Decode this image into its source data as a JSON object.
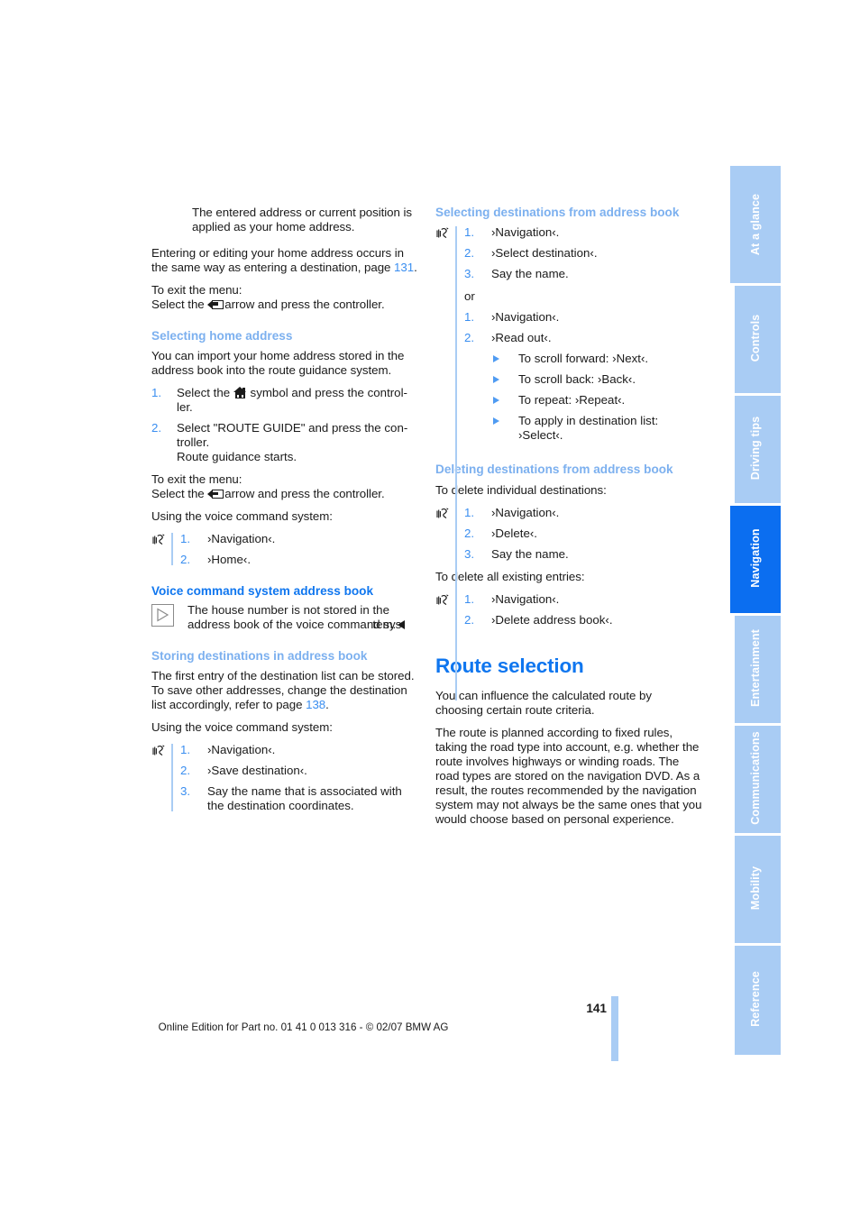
{
  "page": {
    "number": "141",
    "footer": "Online Edition for Part no. 01 41 0 013 316 - © 02/07 BMW AG"
  },
  "colors": {
    "heading_light_blue": "#7cb0ef",
    "heading_blue": "#0f76ef",
    "number_blue": "#3a8ef0",
    "tab_inactive": "#a9ccf4",
    "tab_active": "#0b6ef0",
    "rule_blue": "#a9ccf4",
    "body_text": "#1a1a1a"
  },
  "left_column": {
    "intro": {
      "text": "The entered address or current position is applied as your home address."
    },
    "para_entering": {
      "pre": "Entering or editing your home address occurs in the same way as entering a destination, page ",
      "ref": "131",
      "post": "."
    },
    "exit_menu_1": {
      "line1": "To exit the menu:",
      "line2_pre": "Select the ",
      "line2_post": "arrow and press the controller.",
      "icon": "back-arrow-icon"
    },
    "heading_selecting_home": "Selecting home address",
    "para_import": "You can import your home address stored in the address book into the route guidance system.",
    "steps_home": [
      {
        "num": "1.",
        "pre": "Select the ",
        "post": "symbol and press the control-ler.",
        "icon": "house-icon"
      },
      {
        "num": "2.",
        "text": "Select \"ROUTE GUIDE\" and press the con-troller.",
        "sub": "Route guidance starts."
      }
    ],
    "exit_menu_2": {
      "line1": "To exit the menu:",
      "line2_pre": "Select the ",
      "line2_post": "arrow and press the controller.",
      "icon": "back-arrow-icon"
    },
    "using_voice_1": "Using the voice command system:",
    "voice_steps_1": [
      {
        "num": "1.",
        "text": "›Navigation‹."
      },
      {
        "num": "2.",
        "text": "›Home‹."
      }
    ],
    "heading_vcs_address_book": "Voice command system address book",
    "note": {
      "text": "The house number is not stored in the address book of the voice command sys-",
      "tail": "tem.",
      "icon": "note-triangle-icon",
      "endmark": "end-of-note-marker"
    },
    "heading_storing": "Storing destinations in address book",
    "para_storing": {
      "pre": "The first entry of the destination list can be stored. To save other addresses, change the destination list accordingly, refer to page ",
      "ref": "138",
      "post": "."
    },
    "using_voice_2": "Using the voice command system:",
    "voice_steps_2": [
      {
        "num": "1.",
        "text": "›Navigation‹."
      },
      {
        "num": "2.",
        "text": "›Save destination‹."
      },
      {
        "num": "3.",
        "text": "Say the name that is associated with the destination coordinates."
      }
    ]
  },
  "right_column": {
    "heading_selecting_dest": "Selecting destinations from address book",
    "voice_steps_select_a": [
      {
        "num": "1.",
        "text": "›Navigation‹."
      },
      {
        "num": "2.",
        "text": "›Select destination‹."
      },
      {
        "num": "3.",
        "text": "Say the name."
      }
    ],
    "or_label": "or",
    "voice_steps_select_b": [
      {
        "num": "1.",
        "text": "›Navigation‹."
      },
      {
        "num": "2.",
        "text": "›Read out‹."
      }
    ],
    "readout_options": [
      "To scroll forward: ›Next‹.",
      "To scroll back: ›Back‹.",
      "To repeat: ›Repeat‹.",
      "To apply in destination list: ›Select‹."
    ],
    "heading_deleting": "Deleting destinations from address book",
    "delete_individual_label": "To delete individual destinations:",
    "voice_steps_delete_individual": [
      {
        "num": "1.",
        "text": "›Navigation‹."
      },
      {
        "num": "2.",
        "text": "›Delete‹."
      },
      {
        "num": "3.",
        "text": "Say the name."
      }
    ],
    "delete_all_label": "To delete all existing entries:",
    "voice_steps_delete_all": [
      {
        "num": "1.",
        "text": "›Navigation‹."
      },
      {
        "num": "2.",
        "text": "›Delete address book‹."
      }
    ],
    "heading_route_selection": "Route selection",
    "para_influence": "You can influence the calculated route by choosing certain route criteria.",
    "para_rules": "The route is planned according to fixed rules, taking the road type into account, e.g. whether the route involves highways or winding roads. The road types are stored on the navigation DVD. As a result, the routes recommended by the navigation system may not always be the same ones that you would choose based on personal experience."
  },
  "tabs": [
    {
      "label": "At a glance",
      "active": false
    },
    {
      "label": "Controls",
      "active": false
    },
    {
      "label": "Driving tips",
      "active": false
    },
    {
      "label": "Navigation",
      "active": true
    },
    {
      "label": "Entertainment",
      "active": false
    },
    {
      "label": "Communications",
      "active": false
    },
    {
      "label": "Mobility",
      "active": false
    },
    {
      "label": "Reference",
      "active": false
    }
  ]
}
